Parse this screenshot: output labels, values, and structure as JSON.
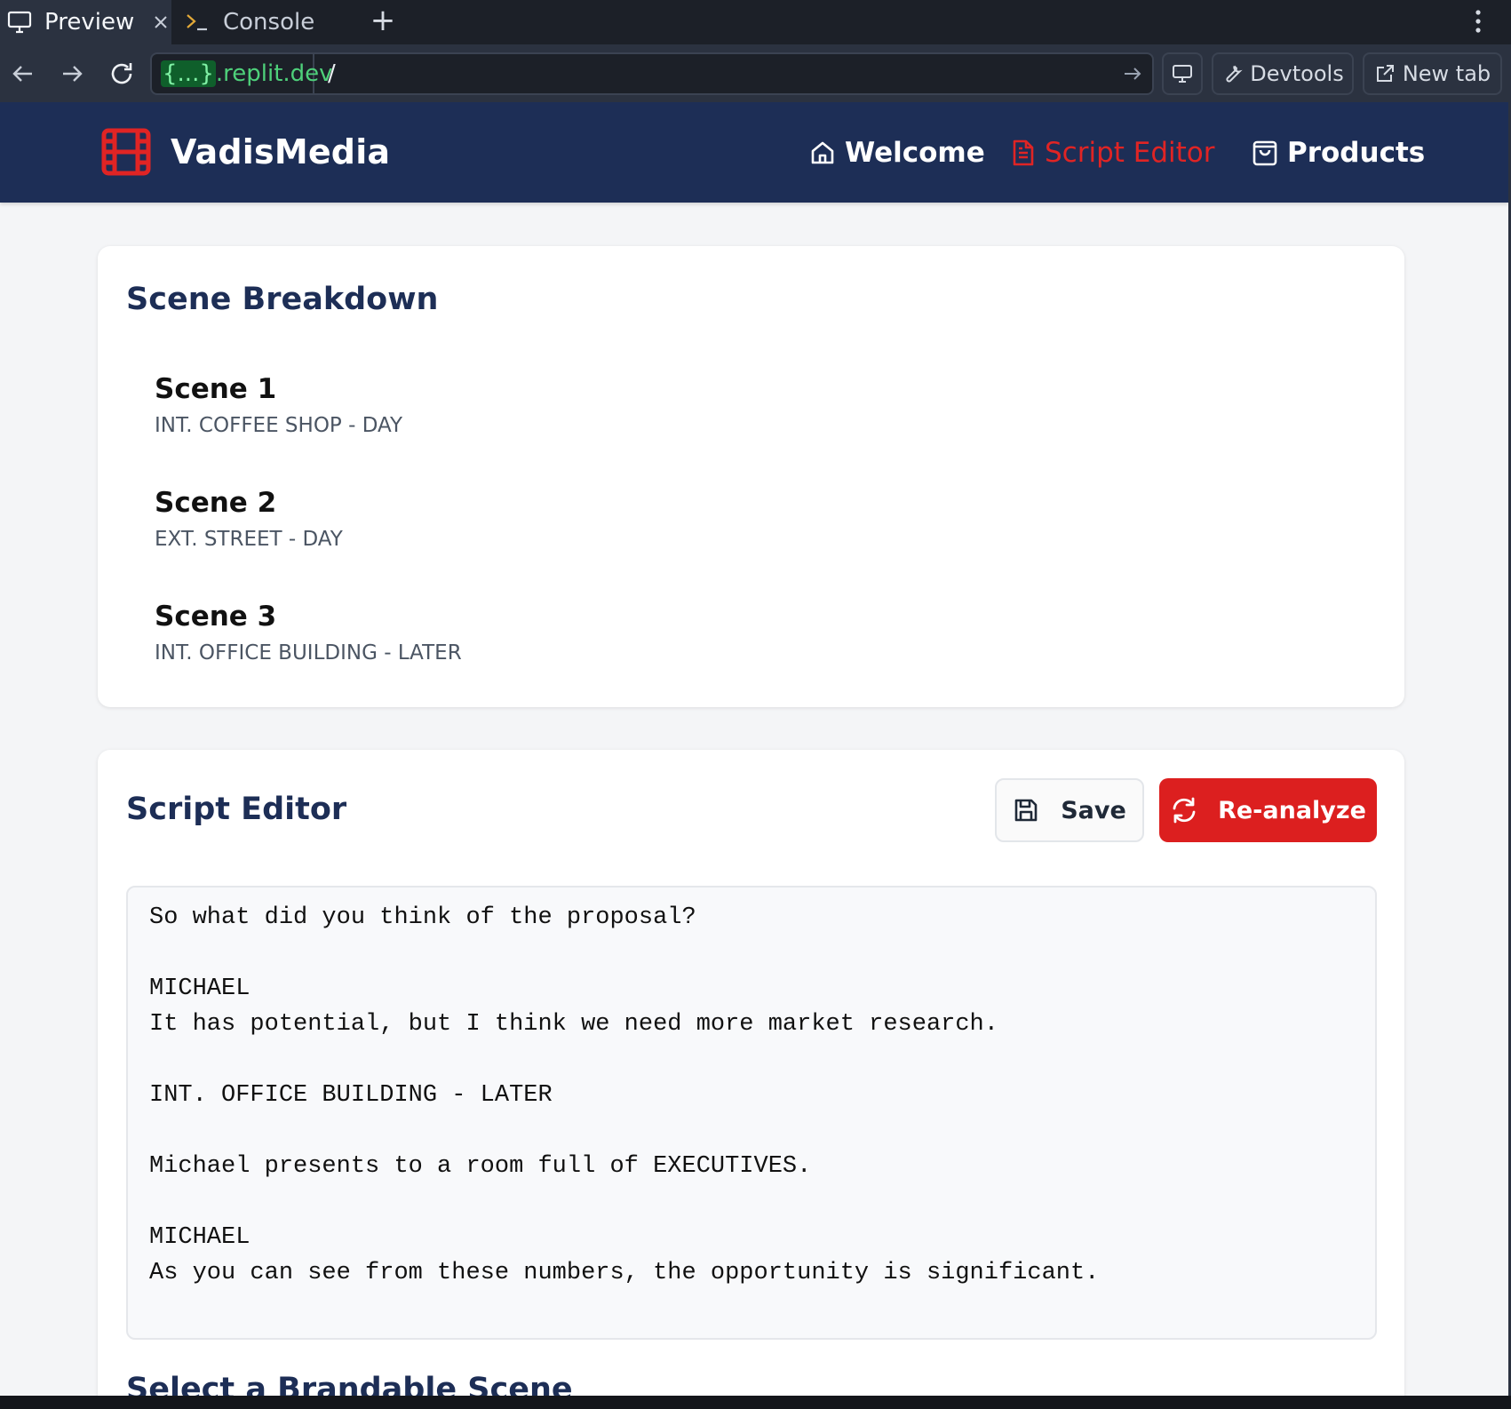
{
  "chrome": {
    "tabs": [
      {
        "label": "Preview",
        "icon": "monitor-icon",
        "active": true
      },
      {
        "label": "Console",
        "icon": "terminal-icon",
        "active": false
      }
    ],
    "new_tab_symbol": "+",
    "url": {
      "host_prefix": "{...}",
      "host_suffix": ".replit.dev",
      "path": "/"
    },
    "buttons": {
      "devtools": "Devtools",
      "new_tab": "New tab"
    }
  },
  "app": {
    "brand": {
      "name": "VadisMedia",
      "icon": "film-icon",
      "color": "#e02424"
    },
    "header_bg": "#1d2e56",
    "nav": [
      {
        "label": "Welcome",
        "icon": "home-icon",
        "active": false
      },
      {
        "label": "Script Editor",
        "icon": "document-icon",
        "active": true
      },
      {
        "label": "Products",
        "icon": "shopping-bag-icon",
        "active": false
      }
    ],
    "scene_breakdown": {
      "title": "Scene Breakdown",
      "scenes": [
        {
          "title": "Scene 1",
          "heading": "INT. COFFEE SHOP - DAY"
        },
        {
          "title": "Scene 2",
          "heading": "EXT. STREET - DAY"
        },
        {
          "title": "Scene 3",
          "heading": "INT. OFFICE BUILDING - LATER"
        }
      ]
    },
    "script_editor": {
      "title": "Script Editor",
      "save_label": "Save",
      "reanalyze_label": "Re-analyze",
      "accent": "#dc1f1f",
      "lines": [
        "So what did you think of the proposal?",
        "",
        "MICHAEL",
        "It has potential, but I think we need more market research.",
        "",
        "INT. OFFICE BUILDING - LATER",
        "",
        "Michael presents to a room full of EXECUTIVES.",
        "",
        "MICHAEL",
        "As you can see from these numbers, the opportunity is significant."
      ]
    },
    "next_section_title": "Select a Brandable Scene"
  }
}
